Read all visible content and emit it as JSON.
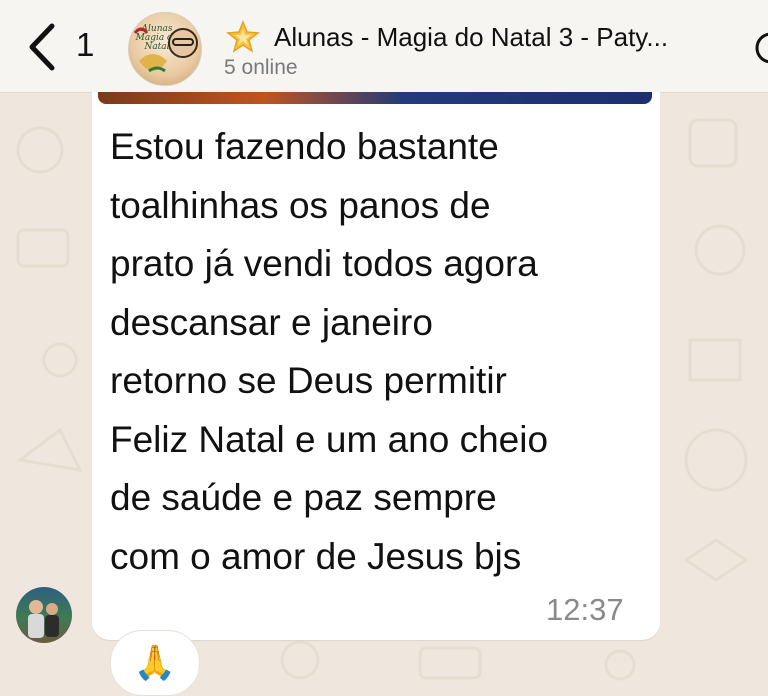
{
  "header": {
    "unread_count": "1",
    "group_title": "Alunas - Magia do Natal 3 - Paty...",
    "status": "5 online",
    "avatar_label": "Alunas Magia do Natal"
  },
  "message": {
    "text": "Estou fazendo bastante\ntoalhinhas os panos de\nprato já vendi todos agora\ndescansar e janeiro\nretorno se Deus permitir\nFeliz Natal e um ano cheio\nde saúde e paz sempre\ncom o amor de Jesus  bjs",
    "time": "12:37"
  },
  "reaction": {
    "emoji": "🙏"
  },
  "icons": {
    "back": "chevron-left-icon",
    "star": "star-icon",
    "more": "chat-bubble-icon"
  },
  "colors": {
    "background": "#efe7dd",
    "header": "#f6f5f2",
    "bubble": "#ffffff"
  }
}
